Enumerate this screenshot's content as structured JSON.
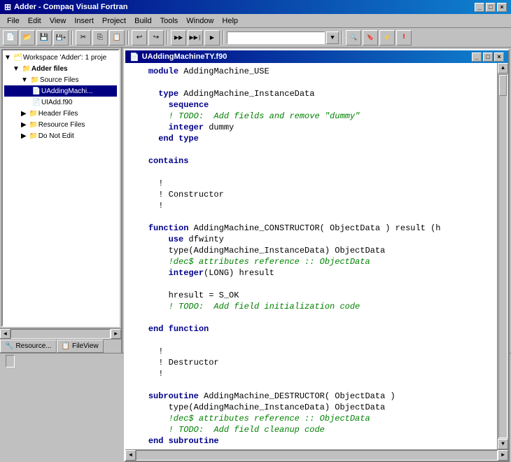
{
  "title_bar": {
    "title": "Adder - Compaq Visual Fortran",
    "buttons": [
      "_",
      "□",
      "×"
    ]
  },
  "menu_bar": {
    "items": [
      "File",
      "Edit",
      "View",
      "Insert",
      "Project",
      "Build",
      "Tools",
      "Window",
      "Help"
    ]
  },
  "toolbar": {
    "search_placeholder": ""
  },
  "left_panel": {
    "workspace_label": "Workspace 'Adder': 1 proje",
    "tree": [
      {
        "level": 0,
        "icon": "workspace",
        "label": "Workspace 'Adder': 1 proje",
        "expanded": true
      },
      {
        "level": 1,
        "icon": "folder",
        "label": "Adder files",
        "expanded": true
      },
      {
        "level": 2,
        "icon": "folder",
        "label": "Source Files",
        "expanded": true
      },
      {
        "level": 3,
        "icon": "file",
        "label": "UAddingMachi...",
        "selected": true
      },
      {
        "level": 3,
        "icon": "file",
        "label": "UIAdd.f90",
        "selected": false
      },
      {
        "level": 2,
        "icon": "folder",
        "label": "Header Files",
        "expanded": false
      },
      {
        "level": 2,
        "icon": "folder",
        "label": "Resource Files",
        "expanded": false
      },
      {
        "level": 2,
        "icon": "folder",
        "label": "Do Not Edit",
        "expanded": false
      }
    ],
    "bottom_tabs": [
      "Resource...",
      "FileView"
    ]
  },
  "code_window": {
    "title": "UAddingMachineTY.f90",
    "buttons": [
      "_",
      "□",
      "×"
    ],
    "lines": [
      {
        "indent": "    ",
        "tokens": [
          {
            "type": "kw",
            "text": "module"
          },
          {
            "type": "normal",
            "text": " AddingMachine_USE"
          }
        ]
      },
      {
        "indent": "",
        "tokens": []
      },
      {
        "indent": "      ",
        "tokens": [
          {
            "type": "kw",
            "text": "type"
          },
          {
            "type": "normal",
            "text": " AddingMachine_InstanceData"
          }
        ]
      },
      {
        "indent": "        ",
        "tokens": [
          {
            "type": "kw",
            "text": "sequence"
          }
        ]
      },
      {
        "indent": "        ",
        "tokens": [
          {
            "type": "comment",
            "text": "! TODO:  Add fields and remove \"dummy\""
          }
        ]
      },
      {
        "indent": "        ",
        "tokens": [
          {
            "type": "kw",
            "text": "integer"
          },
          {
            "type": "normal",
            "text": " dummy"
          }
        ]
      },
      {
        "indent": "      ",
        "tokens": [
          {
            "type": "kw",
            "text": "end type"
          }
        ]
      },
      {
        "indent": "",
        "tokens": []
      },
      {
        "indent": "    ",
        "tokens": [
          {
            "type": "kw",
            "text": "contains"
          }
        ]
      },
      {
        "indent": "",
        "tokens": []
      },
      {
        "indent": "      ",
        "tokens": [
          {
            "type": "normal",
            "text": "!"
          }
        ]
      },
      {
        "indent": "      ",
        "tokens": [
          {
            "type": "normal",
            "text": "! Constructor"
          }
        ]
      },
      {
        "indent": "      ",
        "tokens": [
          {
            "type": "normal",
            "text": "!"
          }
        ]
      },
      {
        "indent": "",
        "tokens": []
      },
      {
        "indent": "    ",
        "tokens": [
          {
            "type": "kw",
            "text": "function"
          },
          {
            "type": "normal",
            "text": " AddingMachine_CONSTRUCTOR( ObjectData ) result (h"
          }
        ]
      },
      {
        "indent": "        ",
        "tokens": [
          {
            "type": "kw",
            "text": "use"
          },
          {
            "type": "normal",
            "text": " dfwinty"
          }
        ]
      },
      {
        "indent": "        ",
        "tokens": [
          {
            "type": "normal",
            "text": "type(AddingMachine_InstanceData) ObjectData"
          }
        ]
      },
      {
        "indent": "        ",
        "tokens": [
          {
            "type": "comment",
            "text": "!dec$ attributes reference :: ObjectData"
          }
        ]
      },
      {
        "indent": "        ",
        "tokens": [
          {
            "type": "kw",
            "text": "integer"
          },
          {
            "type": "normal",
            "text": "(LONG) hresult"
          }
        ]
      },
      {
        "indent": "",
        "tokens": []
      },
      {
        "indent": "        ",
        "tokens": [
          {
            "type": "normal",
            "text": "hresult = S_OK"
          }
        ]
      },
      {
        "indent": "        ",
        "tokens": [
          {
            "type": "comment",
            "text": "! TODO:  Add field initialization code"
          }
        ]
      },
      {
        "indent": "",
        "tokens": []
      },
      {
        "indent": "    ",
        "tokens": [
          {
            "type": "kw",
            "text": "end function"
          }
        ]
      },
      {
        "indent": "",
        "tokens": []
      },
      {
        "indent": "      ",
        "tokens": [
          {
            "type": "normal",
            "text": "!"
          }
        ]
      },
      {
        "indent": "      ",
        "tokens": [
          {
            "type": "normal",
            "text": "! Destructor"
          }
        ]
      },
      {
        "indent": "      ",
        "tokens": [
          {
            "type": "normal",
            "text": "!"
          }
        ]
      },
      {
        "indent": "",
        "tokens": []
      },
      {
        "indent": "    ",
        "tokens": [
          {
            "type": "kw",
            "text": "subroutine"
          },
          {
            "type": "normal",
            "text": " AddingMachine_DESTRUCTOR( ObjectData )"
          }
        ]
      },
      {
        "indent": "        ",
        "tokens": [
          {
            "type": "normal",
            "text": "type(AddingMachine_InstanceData) ObjectData"
          }
        ]
      },
      {
        "indent": "        ",
        "tokens": [
          {
            "type": "comment",
            "text": "!dec$ attributes reference :: ObjectData"
          }
        ]
      },
      {
        "indent": "        ",
        "tokens": [
          {
            "type": "comment",
            "text": "! TODO:  Add field cleanup code"
          }
        ]
      },
      {
        "indent": "    ",
        "tokens": [
          {
            "type": "kw",
            "text": "end subroutine"
          }
        ]
      }
    ]
  },
  "status_bar": {
    "tabs": [
      "Resource...",
      "FileView"
    ]
  }
}
